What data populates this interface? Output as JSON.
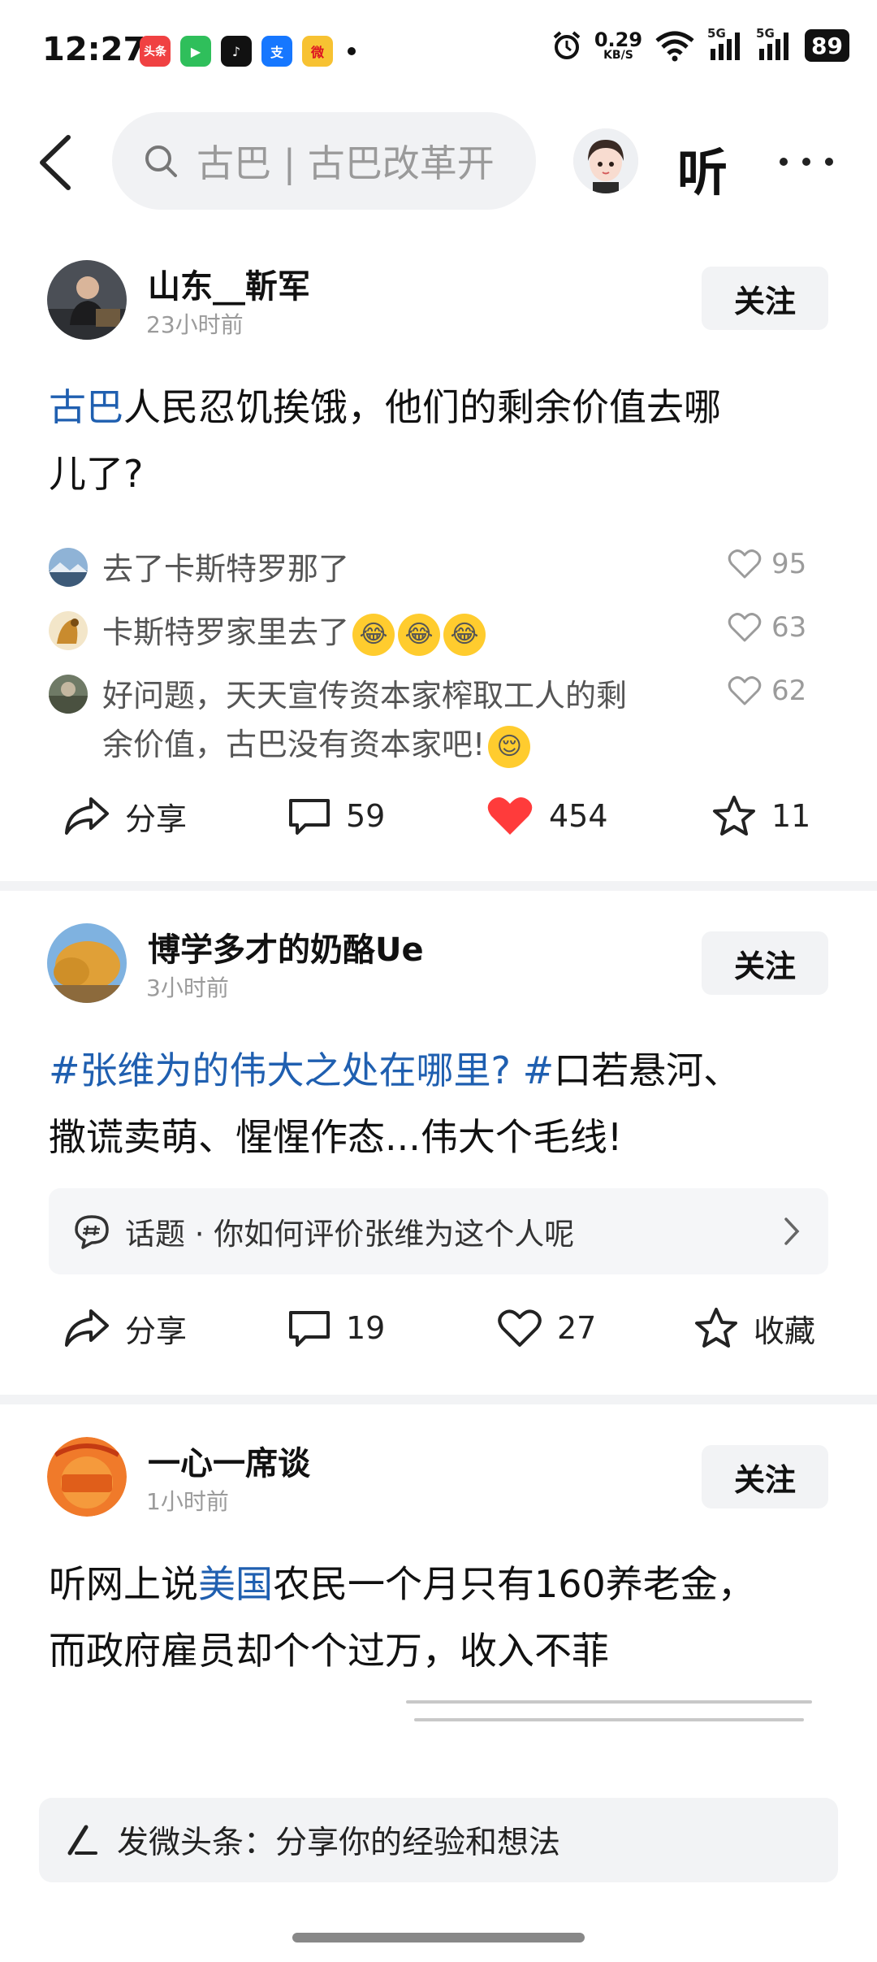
{
  "status_bar": {
    "time": "12:27",
    "apps": [
      {
        "name": "toutiao-app-icon",
        "label": "头条",
        "color": "#f04142"
      },
      {
        "name": "video-app-icon",
        "label": "▶",
        "color": "#2fbf5b"
      },
      {
        "name": "tiktok-app-icon",
        "label": "♪",
        "color": "#111111"
      },
      {
        "name": "alipay-app-icon",
        "label": "支",
        "color": "#1677ff"
      },
      {
        "name": "weibo-app-icon",
        "label": "微",
        "color": "#f7c232"
      }
    ],
    "net_speed_value": "0.29",
    "net_speed_unit": "KB/S",
    "signal_1": "5G",
    "signal_2": "5G",
    "battery": "89"
  },
  "top_nav": {
    "search_placeholder": "古巴 | 古巴改革开",
    "listen_label": "听"
  },
  "posts": [
    {
      "author": "山东__靳军",
      "time": "23小时前",
      "follow_label": "关注",
      "body_highlight": "古巴",
      "body_rest_line1": "人民忍饥挨饿，他们的剩余价值去哪",
      "body_line2": "儿了?",
      "comments": [
        {
          "text": "去了卡斯特罗那了",
          "likes": "95"
        },
        {
          "text": "卡斯特罗家里去了",
          "likes": "63"
        },
        {
          "text_line1": "好问题，天天宣传资本家榨取工人的剩",
          "text_line2": "余价值，古巴没有资本家吧!",
          "likes": "62"
        }
      ],
      "actions": {
        "share": "分享",
        "comments": "59",
        "likes": "454",
        "favorites": "11"
      },
      "colors": {
        "like_active": "#ff3b3b"
      }
    },
    {
      "author": "博学多才的奶酪Ue",
      "time": "3小时前",
      "follow_label": "关注",
      "body_hashtag": "#张维为的伟大之处在哪里? #",
      "body_rest_line1": "口若悬河、",
      "body_line2": "撒谎卖萌、惺惺作态...伟大个毛线!",
      "topic": "话题 · 你如何评价张维为这个人呢",
      "actions": {
        "share": "分享",
        "comments": "19",
        "likes": "27",
        "favorites": "收藏"
      }
    },
    {
      "author": "一心一席谈",
      "time": "1小时前",
      "follow_label": "关注",
      "body_prefix": "听网上说",
      "body_highlight": "美国",
      "body_rest_line1": "农民一个月只有160养老金，",
      "body_line2": "而政府雇员却个个过万，收入不菲"
    }
  ],
  "compose": {
    "placeholder": "发微头条：分享你的经验和想法"
  },
  "colors": {
    "link_blue": "#1f5fb0",
    "accent_red": "#f04142"
  }
}
